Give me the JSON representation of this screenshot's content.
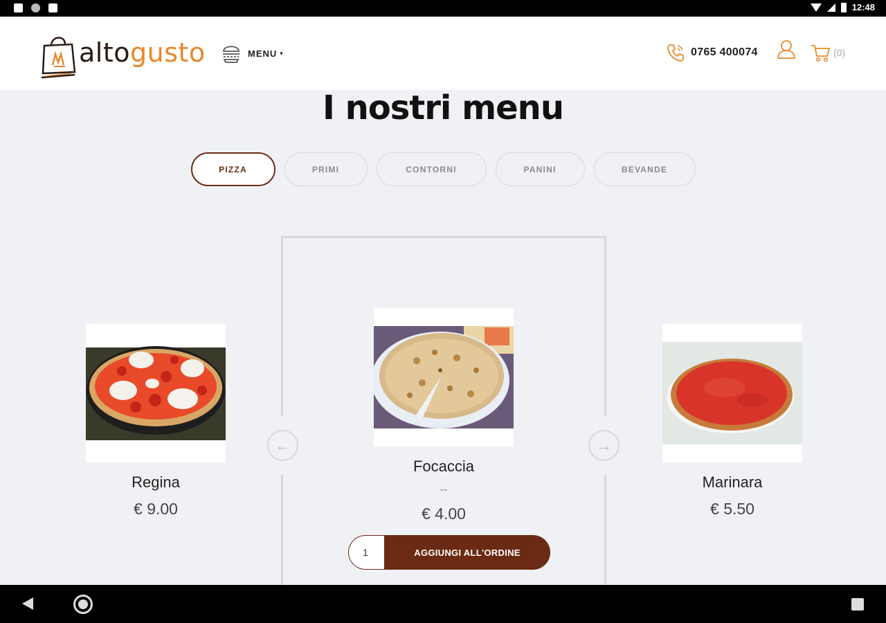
{
  "status_bar": {
    "time": "12:48"
  },
  "header": {
    "logo": {
      "part1": "alto",
      "part2": "gusto"
    },
    "menu_label": "MENU",
    "phone": "0765 400074",
    "cart_count": "(0)"
  },
  "section_title": "I nostri menu",
  "tabs": [
    {
      "label": "PIZZA",
      "active": true
    },
    {
      "label": "PRIMI",
      "active": false
    },
    {
      "label": "CONTORNI",
      "active": false
    },
    {
      "label": "PANINI",
      "active": false
    },
    {
      "label": "BEVANDE",
      "active": false
    }
  ],
  "products": {
    "left": {
      "name": "Regina",
      "price": "€ 9.00"
    },
    "center": {
      "name": "Focaccia",
      "description": "--",
      "price": "€ 4.00",
      "quantity": "1",
      "add_label": "AGGIUNGI ALL'ORDINE"
    },
    "right": {
      "name": "Marinara",
      "price": "€ 5.50"
    }
  },
  "carousel": {
    "prev_icon": "arrow-left-icon",
    "next_icon": "arrow-right-icon"
  },
  "colors": {
    "accent": "#6b2a14",
    "brand_orange": "#e8892b",
    "background": "#f0f1f5"
  }
}
